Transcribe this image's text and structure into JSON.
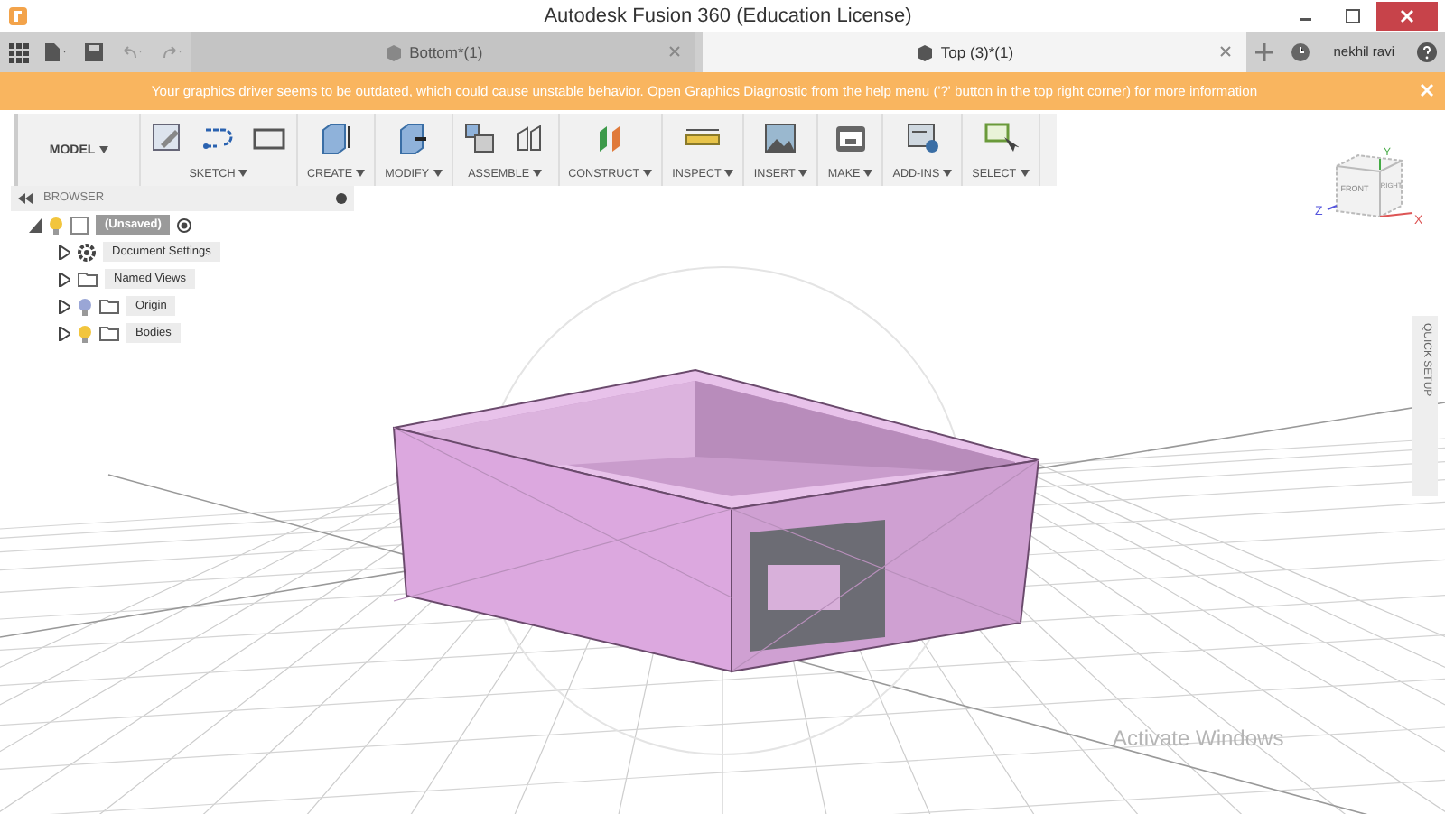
{
  "window": {
    "title": "Autodesk Fusion 360 (Education License)"
  },
  "tabs": [
    {
      "label": "Bottom*(1)",
      "selected": false
    },
    {
      "label": "Top (3)*(1)",
      "selected": true
    }
  ],
  "user": {
    "name": "nekhil ravi"
  },
  "banner": {
    "message": "Your graphics driver seems to be outdated, which could cause unstable behavior. Open Graphics Diagnostic from the help menu ('?' button in the top right corner) for more information"
  },
  "workspace": {
    "label": "MODEL"
  },
  "toolbar": [
    {
      "label": "SKETCH",
      "tools": [
        {
          "kind": "sketch"
        },
        {
          "kind": "line"
        },
        {
          "kind": "rectangle"
        }
      ]
    },
    {
      "label": "CREATE",
      "tools": [
        {
          "kind": "box"
        }
      ]
    },
    {
      "label": "MODIFY",
      "tools": [
        {
          "kind": "press"
        }
      ]
    },
    {
      "label": "ASSEMBLE",
      "tools": [
        {
          "kind": "component"
        },
        {
          "kind": "joint"
        }
      ]
    },
    {
      "label": "CONSTRUCT",
      "tools": [
        {
          "kind": "plane"
        }
      ]
    },
    {
      "label": "INSPECT",
      "tools": [
        {
          "kind": "ruler"
        }
      ]
    },
    {
      "label": "INSERT",
      "tools": [
        {
          "kind": "image"
        }
      ]
    },
    {
      "label": "MAKE",
      "tools": [
        {
          "kind": "printer"
        }
      ]
    },
    {
      "label": "ADD-INS",
      "tools": [
        {
          "kind": "addin"
        }
      ]
    },
    {
      "label": "SELECT",
      "tools": [
        {
          "kind": "select"
        }
      ]
    }
  ],
  "browser": {
    "title": "BROWSER",
    "tree": [
      {
        "label": "(Unsaved)",
        "kind": "document",
        "visible": true,
        "expanded": true,
        "children": [
          {
            "label": "Document Settings",
            "kind": "settings",
            "expanded": false
          },
          {
            "label": "Named Views",
            "kind": "folder",
            "expanded": false
          },
          {
            "label": "Origin",
            "kind": "folder",
            "visible": false,
            "expanded": false
          },
          {
            "label": "Bodies",
            "kind": "folder",
            "visible": true,
            "expanded": false
          }
        ]
      }
    ]
  },
  "view_cube": {
    "y_axis": "Y",
    "faces": [
      "FRONT",
      "RIGHT"
    ],
    "z_axis": "Z",
    "x_axis": "X"
  },
  "quick_setup": {
    "label": "QUICK SETUP"
  },
  "os_notice": {
    "text": "Activate Windows"
  }
}
